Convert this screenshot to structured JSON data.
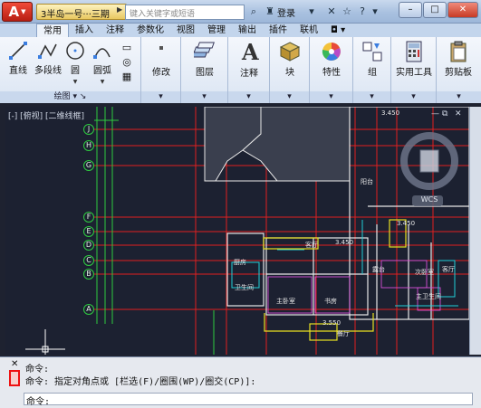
{
  "titlebar": {
    "app_logo": "A",
    "doc_title": "3半岛一号···三期",
    "search_placeholder": "键入关键字或短语",
    "login_label": "登录",
    "help_label": "?",
    "min_label": "–",
    "max_label": "□",
    "close_label": "✕"
  },
  "ribbon": {
    "tabs": [
      "常用",
      "插入",
      "注释",
      "参数化",
      "视图",
      "管理",
      "输出",
      "插件",
      "联机"
    ],
    "active_tab": "常用",
    "draw_panel_title": "绘图",
    "tools": {
      "line": "直线",
      "polyline": "多段线",
      "circle": "圆",
      "arc": "圆弧",
      "modify": "修改",
      "layer": "图层",
      "annotate": "注释",
      "block": "块",
      "properties": "特性",
      "group": "组",
      "utilities": "实用工具",
      "clipboard": "剪贴板"
    }
  },
  "viewport": {
    "label": "[-] [俯视] [二维线框]",
    "axis_letters": [
      "J",
      "H",
      "G",
      "F",
      "E",
      "D",
      "C",
      "B",
      "A"
    ],
    "room_labels": [
      "客厅",
      "主卧室",
      "书房",
      "餐厅",
      "厨房",
      "阳台",
      "卫生间",
      "次卧室",
      "露台",
      "客厅",
      "主卫生间"
    ],
    "dimension_texts": [
      "3.450",
      "3.450",
      "3.550",
      "3.450"
    ],
    "viewcube_label": "WCS"
  },
  "command": {
    "history": [
      "命令:",
      "命令: 指定对角点或 [栏选(F)/圈围(WP)/圈交(CP)]:"
    ],
    "prompt": "命令:",
    "close_label": "✕"
  },
  "colors": {
    "accent": "#c0261a",
    "canvas_bg": "#1c2131",
    "grid_red": "#e02020",
    "axis_green": "#2ecc40",
    "wall_white": "#e8e8e8",
    "room_magenta": "#d94fd9",
    "cyan": "#21d0d8",
    "yellow": "#e8e021"
  }
}
